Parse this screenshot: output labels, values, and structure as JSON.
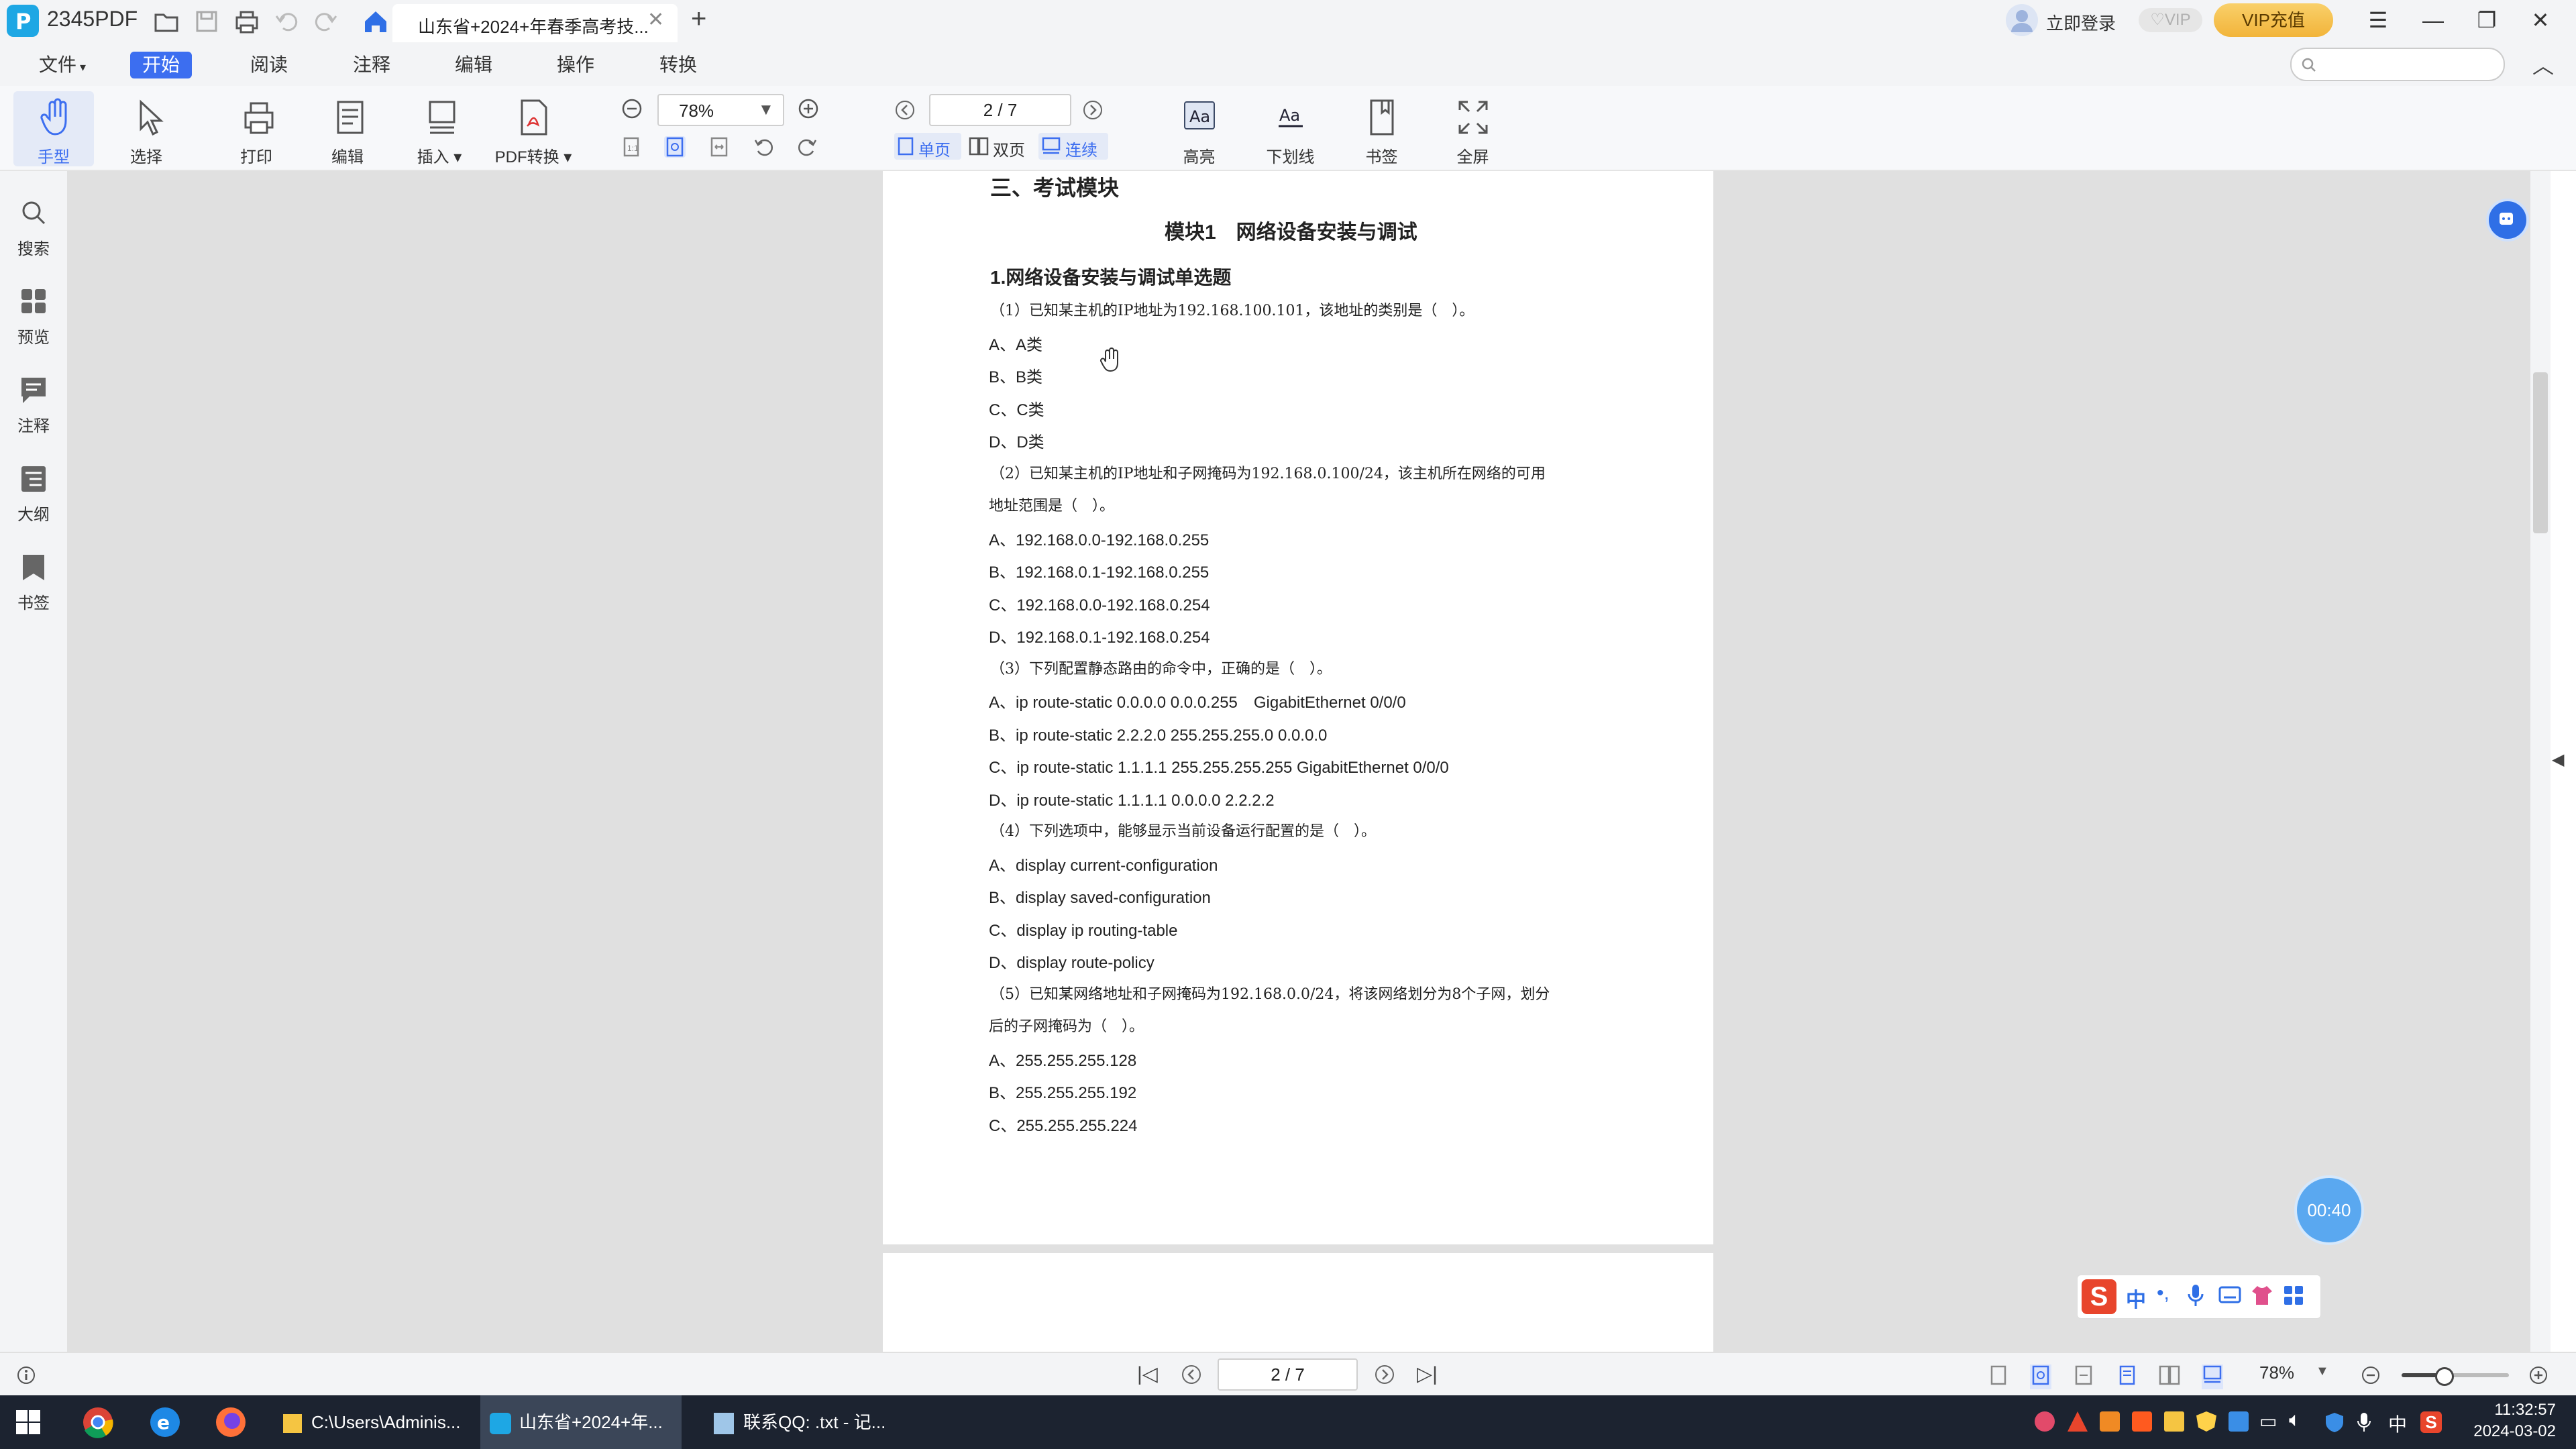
{
  "app": {
    "name": "2345PDF",
    "tab_title": "山东省+2024+年春季高考技...",
    "login": "立即登录",
    "vip": "VIP",
    "vip_recharge": "VIP充值"
  },
  "menu": [
    "文件",
    "开始",
    "阅读",
    "注释",
    "编辑",
    "操作",
    "转换"
  ],
  "menu_active": "开始",
  "toolbar": {
    "hand": "手型",
    "select": "选择",
    "print": "打印",
    "edit": "编辑",
    "insert": "插入",
    "pdf_convert": "PDF转换",
    "zoom": "78%",
    "page": "2 / 7",
    "single": "单页",
    "double": "双页",
    "continuous": "连续",
    "highlight": "高亮",
    "underline": "下划线",
    "bookmark": "书签",
    "fullscreen": "全屏"
  },
  "sidebar": [
    "搜索",
    "预览",
    "注释",
    "大纲",
    "书签"
  ],
  "document": {
    "section": "三、考试模块",
    "module_title": "模块1　网络设备安装与调试",
    "subsection": "1.网络设备安装与调试单选题",
    "lines": [
      "（1）已知某主机的IP地址为192.168.100.101，该地址的类别是（　）。",
      "A、A类",
      "B、B类",
      "C、C类",
      "D、D类",
      "（2）已知某主机的IP地址和子网掩码为192.168.0.100/24，该主机所在网络的可用",
      "地址范围是（　）。",
      "A、192.168.0.0-192.168.0.255",
      "B、192.168.0.1-192.168.0.255",
      "C、192.168.0.0-192.168.0.254",
      "D、192.168.0.1-192.168.0.254",
      "（3）下列配置静态路由的命令中，正确的是（　）。",
      "A、ip route-static 0.0.0.0 0.0.0.255　GigabitEthernet 0/0/0",
      "B、ip route-static 2.2.2.0 255.255.255.0 0.0.0.0",
      "C、ip route-static 1.1.1.1 255.255.255.255 GigabitEthernet 0/0/0",
      "D、ip route-static 1.1.1.1 0.0.0.0 2.2.2.2",
      "（4）下列选项中，能够显示当前设备运行配置的是（　）。",
      "A、display current-configuration",
      "B、display saved-configuration",
      "C、display ip routing-table",
      "D、display route-policy",
      "（5）已知某网络地址和子网掩码为192.168.0.0/24，将该网络划分为8个子网，划分",
      "后的子网掩码为（　）。",
      "A、255.255.255.128",
      "B、255.255.255.192",
      "C、255.255.255.224"
    ]
  },
  "status": {
    "page": "2 / 7",
    "zoom": "78%"
  },
  "timer": "00:40",
  "ime": {
    "lang": "中"
  },
  "taskbar": {
    "explorer": "C:\\Users\\Adminis...",
    "pdf": "山东省+2024+年...",
    "notepad": "联系QQ: .txt - 记...",
    "time": "11:32:57",
    "date": "2024-03-02",
    "lang": "中"
  }
}
